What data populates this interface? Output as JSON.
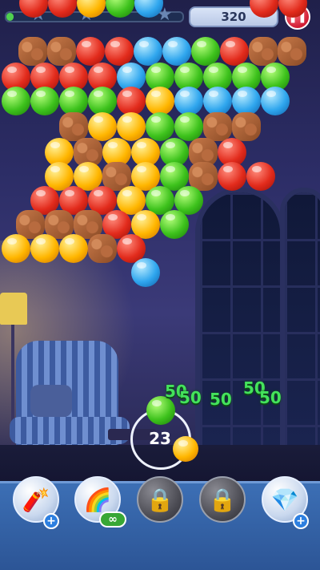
{
  "hud": {
    "score": "320",
    "pause_icon": "pause-icon",
    "level_progress": 0.04,
    "stars_earned": 0,
    "stars_total": 3
  },
  "shooter": {
    "moves_left": "23",
    "current_bubble": "green",
    "next_bubble": "yellow"
  },
  "floating_scores": [
    "50",
    "50",
    "50",
    "50",
    "50"
  ],
  "boosters": [
    {
      "name": "dynamite",
      "icon": "dynamite-icon",
      "badge": "+",
      "locked": false
    },
    {
      "name": "rainbow",
      "icon": "rainbow-icon",
      "badge": "∞",
      "locked": false
    },
    {
      "name": "locked-1",
      "icon": "lock-icon",
      "locked": true
    },
    {
      "name": "locked-2",
      "icon": "lock-icon",
      "locked": true
    },
    {
      "name": "gem",
      "icon": "gem-icon",
      "badge": "+",
      "locked": false
    }
  ],
  "colors": {
    "red": "#e22b1c",
    "green": "#3dc21c",
    "blue": "#2fa6ee",
    "yellow": "#ffb600",
    "rock": "#b86b3f"
  },
  "grid_rows": [
    "r r y g b . . . r r",
    "R R r r b b g r R R",
    "r r r r b g g g g g",
    "g g g g r y b b b b",
    "R y y g g R R",
    "y R y y g R r",
    "y y R y g R r r",
    "r r r y g g",
    "R R R r y g",
    "y y y R r",
    "b"
  ]
}
